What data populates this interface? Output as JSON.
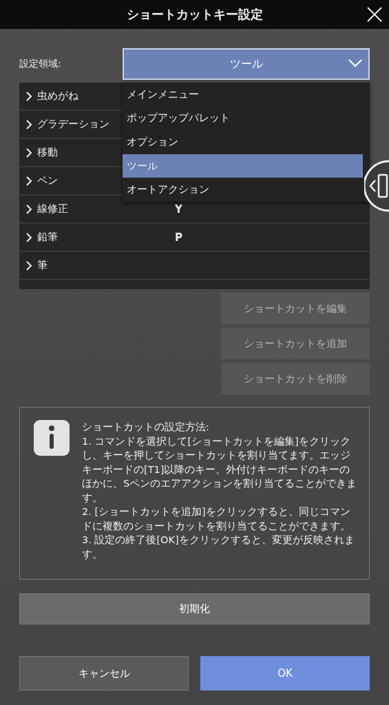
{
  "window": {
    "title": "ショートカットキー設定"
  },
  "area": {
    "label": "設定領域:",
    "value": "ツール",
    "expanded": true,
    "options": [
      {
        "label": "メインメニュー",
        "selected": false
      },
      {
        "label": "ポップアップパレット",
        "selected": false
      },
      {
        "label": "オプション",
        "selected": false
      },
      {
        "label": "ツール",
        "selected": true
      },
      {
        "label": "オートアクション",
        "selected": false
      }
    ]
  },
  "commands": [
    {
      "name": "虫めがね",
      "expanded": false
    },
    {
      "name": "グラデーション",
      "expanded": false
    },
    {
      "name": "移動",
      "expanded": false
    },
    {
      "name": "ペン",
      "expanded": false
    },
    {
      "name": "線修正",
      "shortcut": "Y",
      "expanded": false
    },
    {
      "name": "鉛筆",
      "shortcut": "P",
      "expanded": false
    },
    {
      "name": "筆",
      "expanded": false
    }
  ],
  "actions": [
    {
      "label": "ショートカットを編集",
      "disabled": true
    },
    {
      "label": "ショートカットを追加",
      "disabled": true
    },
    {
      "label": "ショートカットを削除",
      "disabled": true
    }
  ],
  "info": "ショートカットの設定方法:\n1. コマンドを選択して[ショートカットを編集]をクリックし、キーを押してショートカットを割り当てます。エッジキーボードの[T1]以降のキー、外付けキーボードのキーのほかに、Sペンのエアアクションを割り当てることができます。\n2. [ショートカットを追加]をクリックすると、同じコマンドに複数のショートカットを割り当てることができます。\n3. 設定の終了後[OK]をクリックすると、変更が反映されます。",
  "reset": "初期化",
  "buttons": [
    {
      "label": "キャンセル",
      "kind": "secondary"
    },
    {
      "label": "OK",
      "kind": "primary"
    }
  ]
}
